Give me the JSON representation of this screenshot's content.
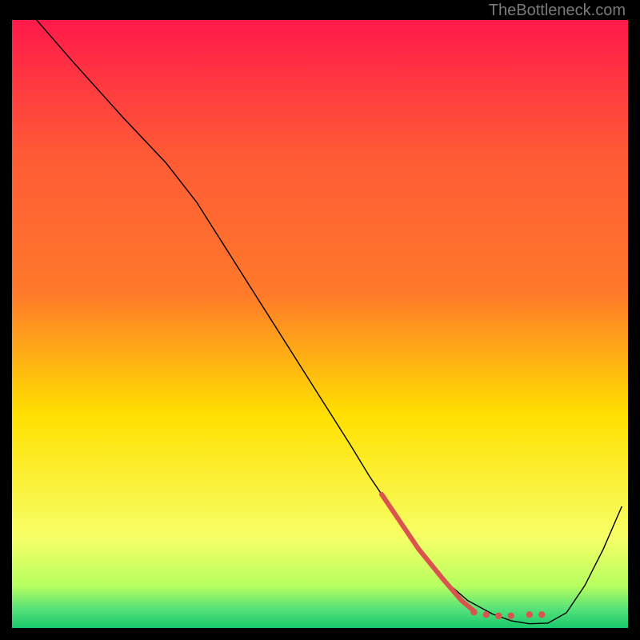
{
  "watermark": "TheBottleneck.com",
  "chart_data": {
    "type": "line",
    "title": "",
    "xlabel": "",
    "ylabel": "",
    "xlim": [
      0,
      100
    ],
    "ylim": [
      0,
      100
    ],
    "background_gradient": {
      "top": "#ff1a4a",
      "mid1": "#ff7a2a",
      "mid2": "#ffe000",
      "low": "#f7ff66",
      "band1": "#b8ff60",
      "band2": "#53e07a",
      "bottom": "#19c96b"
    },
    "series": [
      {
        "name": "curve",
        "color": "#000000",
        "stroke_width": 1.4,
        "x": [
          4,
          10,
          18,
          25,
          30,
          35,
          40,
          45,
          50,
          55,
          58,
          60,
          63,
          66,
          70,
          74,
          78,
          81,
          84,
          87,
          90,
          93,
          96,
          99
        ],
        "y": [
          100,
          93,
          84,
          76.5,
          70,
          62,
          54,
          46,
          38,
          30,
          25,
          22,
          17.5,
          13,
          8,
          4.5,
          2.3,
          1.2,
          0.7,
          0.8,
          2.5,
          7,
          13,
          20
        ]
      },
      {
        "name": "highlight-segment",
        "color": "#d9534f",
        "stroke_width": 6,
        "x": [
          60,
          63,
          66,
          70,
          73,
          75
        ],
        "y": [
          22,
          17.5,
          13,
          8,
          4.5,
          2.8
        ]
      }
    ],
    "highlight_dots": {
      "color": "#d9534f",
      "radius": 4.2,
      "points": [
        {
          "x": 75,
          "y": 2.6
        },
        {
          "x": 77,
          "y": 2.2
        },
        {
          "x": 79,
          "y": 2.0
        },
        {
          "x": 81,
          "y": 2.0
        },
        {
          "x": 84,
          "y": 2.2
        },
        {
          "x": 86,
          "y": 2.2
        }
      ]
    }
  }
}
